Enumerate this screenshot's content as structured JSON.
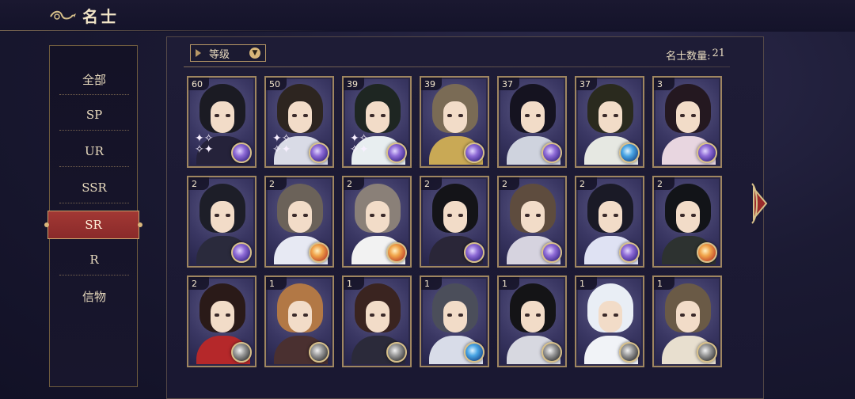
{
  "header": {
    "title": "名士",
    "back_icon": "cloud-back-icon"
  },
  "sidebar": {
    "items": [
      {
        "label": "全部",
        "active": false
      },
      {
        "label": "SP",
        "active": false
      },
      {
        "label": "UR",
        "active": false
      },
      {
        "label": "SSR",
        "active": false
      },
      {
        "label": "SR",
        "active": true
      },
      {
        "label": "R",
        "active": false
      },
      {
        "label": "信物",
        "active": false
      }
    ]
  },
  "toolbar": {
    "sort_label": "等级",
    "sort_icon": "chevron-down-icon",
    "count_label": "名士数量:",
    "count_value": "21"
  },
  "colors": {
    "frame_gold": "#b79866",
    "active_red": "#a23834",
    "background": "#1b1a33"
  },
  "cards": [
    {
      "level": "60",
      "emblem": "purple",
      "hair": "#1b1b23",
      "body": "#25223a",
      "sparkle": true
    },
    {
      "level": "50",
      "emblem": "purple",
      "hair": "#2d2520",
      "body": "#d9dbe6",
      "sparkle": true
    },
    {
      "level": "39",
      "emblem": "purple",
      "hair": "#1e2622",
      "body": "#e8eef0",
      "sparkle": true
    },
    {
      "level": "39",
      "emblem": "purple",
      "hair": "#7a6b55",
      "body": "#c9a955",
      "sparkle": false
    },
    {
      "level": "37",
      "emblem": "purple",
      "hair": "#151320",
      "body": "#cfd3de",
      "sparkle": false
    },
    {
      "level": "37",
      "emblem": "blue",
      "hair": "#2a2a1e",
      "body": "#e6e8e2",
      "sparkle": false
    },
    {
      "level": "3",
      "emblem": "purple",
      "hair": "#241820",
      "body": "#e8d6e0",
      "sparkle": false
    },
    {
      "level": "2",
      "emblem": "purple",
      "hair": "#1d1e28",
      "body": "#2a2a3c",
      "sparkle": false
    },
    {
      "level": "2",
      "emblem": "orange",
      "hair": "#6b6259",
      "body": "#e7e9f3",
      "sparkle": false
    },
    {
      "level": "2",
      "emblem": "orange",
      "hair": "#8a8078",
      "body": "#f2f2f2",
      "sparkle": false
    },
    {
      "level": "2",
      "emblem": "purple",
      "hair": "#141418",
      "body": "#2a2638",
      "sparkle": false
    },
    {
      "level": "2",
      "emblem": "purple",
      "hair": "#5e4c3e",
      "body": "#d6d3df",
      "sparkle": false
    },
    {
      "level": "2",
      "emblem": "purple",
      "hair": "#1a1a26",
      "body": "#dfe2f3",
      "sparkle": false
    },
    {
      "level": "2",
      "emblem": "orange",
      "hair": "#121418",
      "body": "#2d3230",
      "sparkle": false
    },
    {
      "level": "2",
      "emblem": "gray",
      "hair": "#2a1a18",
      "body": "#b5282a",
      "sparkle": false
    },
    {
      "level": "1",
      "emblem": "gray",
      "hair": "#b27845",
      "body": "#4a3030",
      "sparkle": false
    },
    {
      "level": "1",
      "emblem": "gray",
      "hair": "#3a2420",
      "body": "#2b2a3a",
      "sparkle": false
    },
    {
      "level": "1",
      "emblem": "blue",
      "hair": "#4b4e5a",
      "body": "#d8dce8",
      "sparkle": false
    },
    {
      "level": "1",
      "emblem": "gray",
      "hair": "#141416",
      "body": "#d7d8e0",
      "sparkle": false
    },
    {
      "level": "1",
      "emblem": "gray",
      "hair": "#e9eef5",
      "body": "#f1f3f7",
      "sparkle": false
    },
    {
      "level": "1",
      "emblem": "gray",
      "hair": "#6a5a46",
      "body": "#e8dfcf",
      "sparkle": false
    }
  ]
}
